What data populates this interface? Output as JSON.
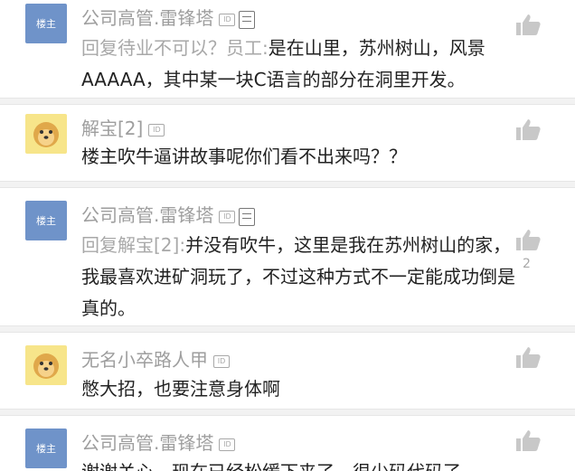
{
  "comments": [
    {
      "avatar_label": "楼主",
      "username": "公司高管.雷锋塔",
      "reply_prefix": "回复待业不可以？员工:",
      "text": "是在山里，苏州树山，风景AAAAA，其中某一块C语言的部分在洞里开发。"
    },
    {
      "username": "解宝[2]",
      "text": "楼主吹牛逼讲故事呢你们看不出来吗？？"
    },
    {
      "avatar_label": "楼主",
      "username": "公司高管.雷锋塔",
      "reply_prefix": "回复解宝[2]:",
      "text": "并没有吹牛，这里是我在苏州树山的家，我最喜欢进矿洞玩了，不过这种方式不一定能成功倒是真的。",
      "likes": "2"
    },
    {
      "username": "无名小卒路人甲",
      "text": "憋大招，也要注意身体啊"
    },
    {
      "avatar_label": "楼主",
      "username": "公司高管.雷锋塔",
      "text": "谢谢关心，现在已经松缓下来了，很少码代码了"
    }
  ],
  "badge_label": "ID",
  "icons": {
    "like": "thumbs-up-icon",
    "badge": "id-badge-icon",
    "doc": "document-icon",
    "avatar_cartoon": "cartoon-face-icon"
  },
  "colors": {
    "username": "#9e9e9e",
    "avatar_blue": "#6f93c9",
    "avatar_yellow": "#f7e58a",
    "separator": "#f2f2f2"
  }
}
